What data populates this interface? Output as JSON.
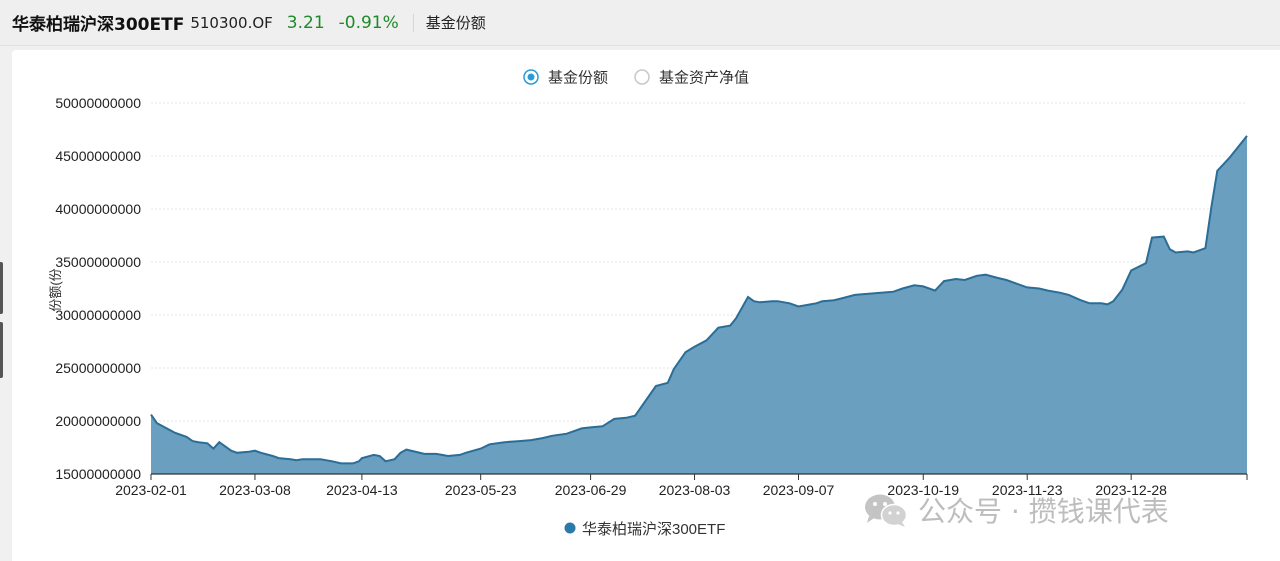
{
  "header": {
    "fund_name": "华泰柏瑞沪深300ETF",
    "fund_code": "510300.OF",
    "price": "3.21",
    "change": "-0.91%",
    "metric_label": "基金份额"
  },
  "toggle": {
    "options": [
      {
        "label": "基金份额",
        "selected": true
      },
      {
        "label": "基金资产净值",
        "selected": false
      }
    ]
  },
  "colors": {
    "area_fill": "#6a9fbf",
    "line": "#2a6d97",
    "legend_dot": "#2a7aa8",
    "positive_green": "#1f8a2a"
  },
  "watermark": {
    "text": "公众号 · 攒钱课代表",
    "icon": "wechat-icon"
  },
  "chart_data": {
    "type": "area",
    "ylabel": "份额(份",
    "ylim": [
      15000000000,
      50000000000
    ],
    "yticks": [
      "50000000000",
      "45000000000",
      "40000000000",
      "35000000000",
      "30000000000",
      "25000000000",
      "20000000000",
      "15000000000"
    ],
    "xticks": [
      "2023-02-01",
      "2023-03-08",
      "2023-04-13",
      "2023-05-23",
      "2023-06-29",
      "2023-08-03",
      "2023-09-07",
      "2023-10-19",
      "2023-11-23",
      "2023-12-28"
    ],
    "grid": true,
    "legend_position": "bottom-center",
    "series": [
      {
        "name": "华泰柏瑞沪深300ETF",
        "x": [
          "2023-02-01",
          "2023-02-03",
          "2023-02-07",
          "2023-02-09",
          "2023-02-13",
          "2023-02-15",
          "2023-02-17",
          "2023-02-20",
          "2023-02-22",
          "2023-02-24",
          "2023-02-28",
          "2023-03-02",
          "2023-03-06",
          "2023-03-08",
          "2023-03-10",
          "2023-03-14",
          "2023-03-16",
          "2023-03-20",
          "2023-03-22",
          "2023-03-24",
          "2023-03-28",
          "2023-03-30",
          "2023-04-03",
          "2023-04-06",
          "2023-04-10",
          "2023-04-12",
          "2023-04-13",
          "2023-04-17",
          "2023-04-19",
          "2023-04-21",
          "2023-04-24",
          "2023-04-26",
          "2023-04-28",
          "2023-05-04",
          "2023-05-08",
          "2023-05-10",
          "2023-05-12",
          "2023-05-16",
          "2023-05-18",
          "2023-05-23",
          "2023-05-26",
          "2023-05-31",
          "2023-06-05",
          "2023-06-09",
          "2023-06-13",
          "2023-06-16",
          "2023-06-21",
          "2023-06-26",
          "2023-06-29",
          "2023-07-03",
          "2023-07-07",
          "2023-07-11",
          "2023-07-14",
          "2023-07-19",
          "2023-07-21",
          "2023-07-25",
          "2023-07-27",
          "2023-07-31",
          "2023-08-03",
          "2023-08-07",
          "2023-08-09",
          "2023-08-11",
          "2023-08-15",
          "2023-08-17",
          "2023-08-21",
          "2023-08-23",
          "2023-08-25",
          "2023-08-29",
          "2023-08-31",
          "2023-09-04",
          "2023-09-07",
          "2023-09-11",
          "2023-09-13",
          "2023-09-15",
          "2023-09-19",
          "2023-09-22",
          "2023-09-26",
          "2023-10-09",
          "2023-10-12",
          "2023-10-16",
          "2023-10-19",
          "2023-10-23",
          "2023-10-26",
          "2023-10-30",
          "2023-11-02",
          "2023-11-06",
          "2023-11-09",
          "2023-11-13",
          "2023-11-16",
          "2023-11-20",
          "2023-11-23",
          "2023-11-27",
          "2023-11-30",
          "2023-12-04",
          "2023-12-07",
          "2023-12-11",
          "2023-12-14",
          "2023-12-18",
          "2023-12-20",
          "2023-12-22",
          "2023-12-25",
          "2023-12-28",
          "2024-01-02",
          "2024-01-04",
          "2024-01-08",
          "2024-01-10",
          "2024-01-12",
          "2024-01-16",
          "2024-01-18",
          "2024-01-22",
          "2024-01-24",
          "2024-01-26",
          "2024-01-30",
          "2024-02-01",
          "2024-02-05"
        ],
        "values": [
          20600000000,
          19800000000,
          19200000000,
          18900000000,
          18500000000,
          18100000000,
          18000000000,
          17900000000,
          17400000000,
          18000000000,
          17200000000,
          17000000000,
          17100000000,
          17200000000,
          17000000000,
          16700000000,
          16500000000,
          16400000000,
          16300000000,
          16400000000,
          16400000000,
          16400000000,
          16200000000,
          16000000000,
          16000000000,
          16200000000,
          16500000000,
          16800000000,
          16700000000,
          16200000000,
          16400000000,
          17000000000,
          17300000000,
          16900000000,
          16900000000,
          16800000000,
          16700000000,
          16800000000,
          17000000000,
          17400000000,
          17800000000,
          18000000000,
          18100000000,
          18200000000,
          18400000000,
          18600000000,
          18800000000,
          19300000000,
          19400000000,
          19500000000,
          20200000000,
          20300000000,
          20500000000,
          22500000000,
          23300000000,
          23600000000,
          24900000000,
          26500000000,
          27000000000,
          27600000000,
          28200000000,
          28800000000,
          29000000000,
          29700000000,
          31700000000,
          31300000000,
          31200000000,
          31300000000,
          31300000000,
          31100000000,
          30800000000,
          31000000000,
          31100000000,
          31300000000,
          31400000000,
          31600000000,
          31900000000,
          32200000000,
          32500000000,
          32800000000,
          32700000000,
          32300000000,
          33200000000,
          33400000000,
          33300000000,
          33700000000,
          33800000000,
          33500000000,
          33300000000,
          32900000000,
          32600000000,
          32500000000,
          32300000000,
          32100000000,
          31900000000,
          31400000000,
          31100000000,
          31100000000,
          31000000000,
          31300000000,
          32400000000,
          34200000000,
          34900000000,
          37300000000,
          37400000000,
          36200000000,
          35900000000,
          36000000000,
          35900000000,
          36300000000,
          40200000000,
          43600000000,
          44800000000,
          45500000000,
          46900000000
        ]
      }
    ]
  }
}
